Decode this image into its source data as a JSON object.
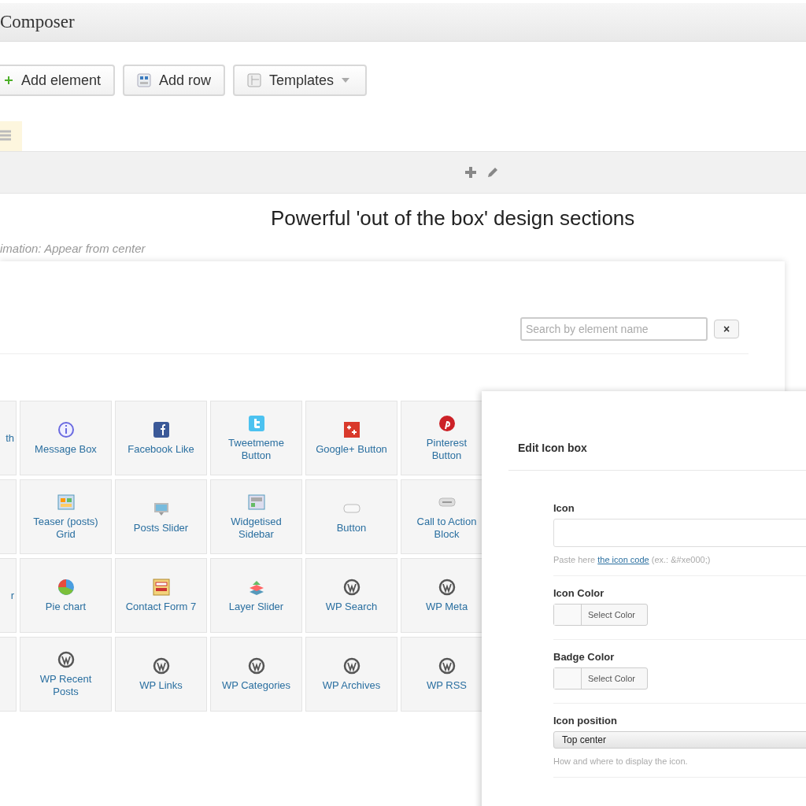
{
  "window": {
    "title": "Composer"
  },
  "toolbar": {
    "buttons": [
      {
        "label": "Add element",
        "kind": "add"
      },
      {
        "label": "Add row",
        "kind": "row"
      },
      {
        "label": "Templates",
        "kind": "templates"
      }
    ]
  },
  "section": {
    "heading": "Powerful 'out of the box' design sections",
    "note": "imation: Appear from center"
  },
  "picker": {
    "search": {
      "placeholder": "Search by element name"
    },
    "close": "×",
    "rows": [
      {
        "cut_label": "th",
        "cells": [
          "Message Box",
          "Facebook Like",
          "Tweetmeme Button",
          "Google+ Button",
          "Pinterest Button"
        ]
      },
      {
        "cells": [
          "Teaser (posts) Grid",
          "Posts Slider",
          "Widgetised Sidebar",
          "Button",
          "Call to Action Block"
        ]
      },
      {
        "cut_label": "r",
        "cells": [
          "Pie chart",
          "Contact Form 7",
          "Layer Slider",
          "WP Search",
          "WP Meta"
        ]
      },
      {
        "cells": [
          "WP Recent Posts",
          "WP Links",
          "WP Categories",
          "WP Archives",
          "WP RSS"
        ]
      }
    ]
  },
  "edit_panel": {
    "title": "Edit Icon box",
    "fields": [
      {
        "kind": "text",
        "label": "Icon",
        "help_before": "Paste here",
        "help_link": "the icon code",
        "help_after": "(ex.: &#xe000;)"
      },
      {
        "kind": "color",
        "label": "Icon Color",
        "button": "Select Color"
      },
      {
        "kind": "color",
        "label": "Badge Color",
        "button": "Select Color"
      },
      {
        "kind": "select",
        "label": "Icon position",
        "value": "Top center",
        "help": "How and where to display the icon."
      }
    ]
  }
}
